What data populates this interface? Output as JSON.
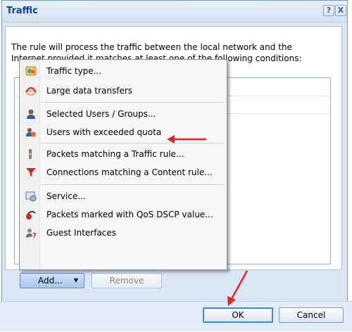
{
  "dialog": {
    "title": "Traffic",
    "help_label": "?",
    "close_label": "X",
    "description": "The rule will process the traffic between the local network and the Internet provided it matches at least one of the following conditions:"
  },
  "menu": {
    "items": [
      {
        "label": "Traffic type...",
        "icon": "traffic-type-icon"
      },
      {
        "label": "Large data transfers",
        "icon": "large-data-icon"
      },
      {
        "label": "Selected Users / Groups...",
        "icon": "user-icon"
      },
      {
        "label": "Users with exceeded quota",
        "icon": "users-quota-icon"
      },
      {
        "label": "Packets matching a Traffic rule...",
        "icon": "traffic-rule-icon"
      },
      {
        "label": "Connections matching a Content rule...",
        "icon": "filter-icon"
      },
      {
        "label": "Service...",
        "icon": "service-icon"
      },
      {
        "label": "Packets marked with QoS DSCP value...",
        "icon": "qos-dscp-icon"
      },
      {
        "label": "Guest Interfaces",
        "icon": "guest-interfaces-icon"
      }
    ]
  },
  "buttons": {
    "add": "Add...",
    "remove": "Remove",
    "ok": "OK",
    "cancel": "Cancel"
  },
  "colors": {
    "annotation_arrow": "#e0262b",
    "title_text": "#15428b"
  }
}
